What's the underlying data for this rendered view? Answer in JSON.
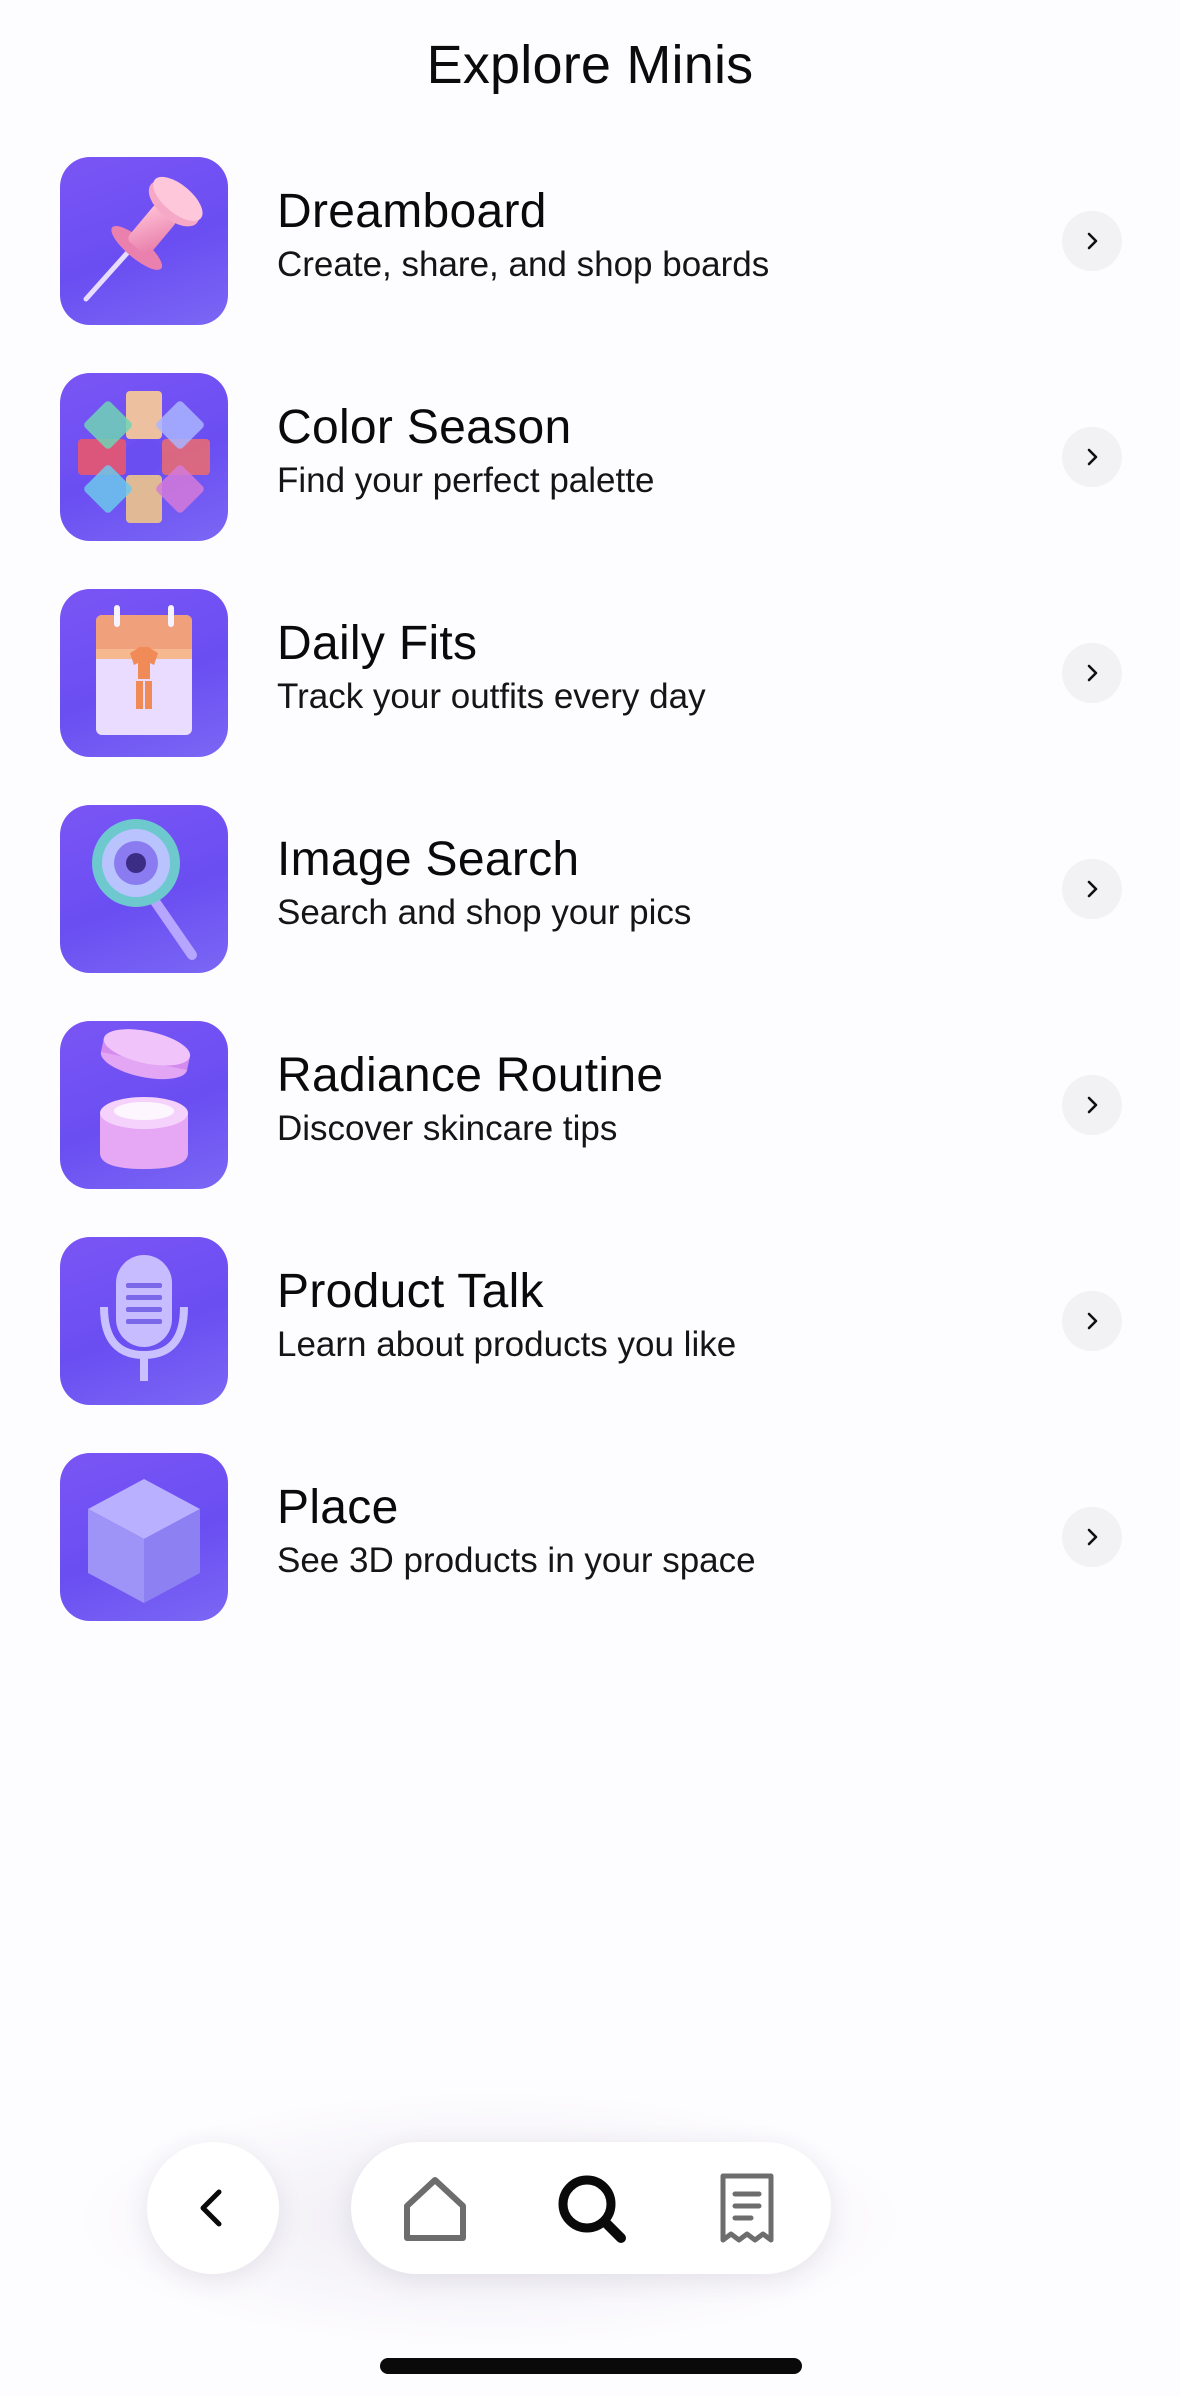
{
  "header": {
    "title": "Explore Minis"
  },
  "minis": [
    {
      "name": "Dreamboard",
      "description": "Create, share, and shop boards",
      "icon": "pushpin-icon"
    },
    {
      "name": "Color Season",
      "description": "Find your perfect palette",
      "icon": "color-palette-icon"
    },
    {
      "name": "Daily Fits",
      "description": "Track your outfits every day",
      "icon": "calendar-outfit-icon"
    },
    {
      "name": "Image Search",
      "description": "Search and shop your pics",
      "icon": "magnifier-icon"
    },
    {
      "name": "Radiance Routine",
      "description": "Discover skincare tips",
      "icon": "skincare-jar-icon"
    },
    {
      "name": "Product Talk",
      "description": "Learn about products you like",
      "icon": "microphone-icon"
    },
    {
      "name": "Place",
      "description": "See 3D products in your space",
      "icon": "cube-icon"
    }
  ],
  "bottom_nav": {
    "back_icon": "chevron-left-icon",
    "items": [
      {
        "icon": "home-icon",
        "active": false
      },
      {
        "icon": "search-icon",
        "active": true
      },
      {
        "icon": "receipt-icon",
        "active": false
      }
    ]
  },
  "colors": {
    "accent": "#6b4ef2",
    "background": "#fdfcfe",
    "chevron_background": "#f2f2f4",
    "nav_inactive": "#6d6d6d",
    "nav_active": "#0a0a0a"
  }
}
